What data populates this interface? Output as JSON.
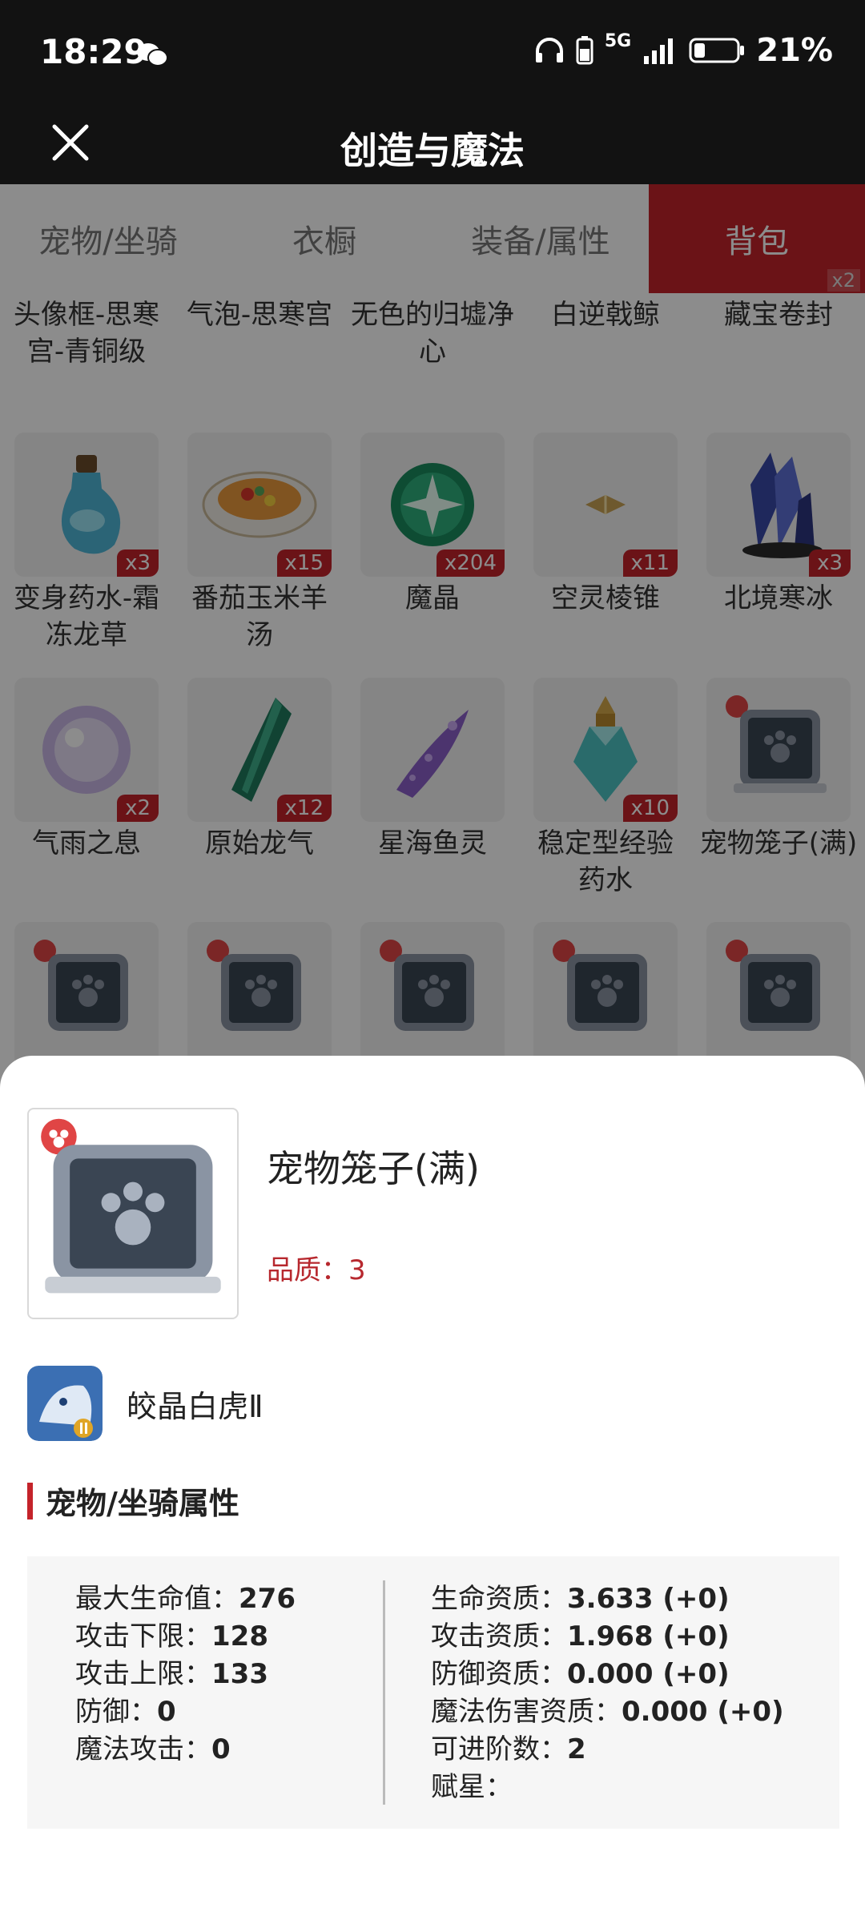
{
  "status_bar": {
    "time": "18:29",
    "network": "5G",
    "battery": "21%"
  },
  "header": {
    "title": "创造与魔法"
  },
  "tabs": [
    {
      "label": "宠物/坐骑",
      "active": false
    },
    {
      "label": "衣橱",
      "active": false
    },
    {
      "label": "装备/属性",
      "active": false
    },
    {
      "label": "背包",
      "active": true,
      "badge": "x2"
    }
  ],
  "inventory": {
    "partial_row": [
      "头像框-思寒宫-青铜级",
      "气泡-思寒宫",
      "无色的归墟净心",
      "白逆戟鲸",
      "藏宝卷封"
    ],
    "rows": [
      [
        {
          "name": "变身药水-霜冻龙草",
          "count": "x3",
          "icon": "potion-icon"
        },
        {
          "name": "番茄玉米羊汤",
          "count": "x15",
          "icon": "soup-bowl-icon"
        },
        {
          "name": "魔晶",
          "count": "x204",
          "icon": "magic-crystal-icon"
        },
        {
          "name": "空灵棱锥",
          "count": "x11",
          "icon": "pyramid-icon"
        },
        {
          "name": "北境寒冰",
          "count": "x3",
          "icon": "ice-crystal-icon"
        }
      ],
      [
        {
          "name": "气雨之息",
          "count": "x2",
          "icon": "orb-icon"
        },
        {
          "name": "原始龙气",
          "count": "x12",
          "icon": "dragon-shard-icon"
        },
        {
          "name": "星海鱼灵",
          "count": "",
          "icon": "star-fish-spirit-icon"
        },
        {
          "name": "稳定型经验药水",
          "count": "x10",
          "icon": "exp-potion-icon"
        },
        {
          "name": "宠物笼子(满)",
          "count": "",
          "icon": "pet-cage-icon"
        }
      ],
      [
        {
          "name": "",
          "count": "",
          "icon": "pet-cage-icon"
        },
        {
          "name": "",
          "count": "",
          "icon": "pet-cage-icon"
        },
        {
          "name": "",
          "count": "",
          "icon": "pet-cage-icon"
        },
        {
          "name": "",
          "count": "",
          "icon": "pet-cage-icon"
        },
        {
          "name": "",
          "count": "",
          "icon": "pet-cage-icon"
        }
      ]
    ]
  },
  "detail": {
    "item_name": "宠物笼子(满)",
    "quality": "品质：3",
    "pet_name": "皎晶白虎Ⅱ",
    "section_title": "宠物/坐骑属性",
    "left_attrs": [
      {
        "label": "最大生命值：",
        "value": "276"
      },
      {
        "label": "攻击下限：",
        "value": "128"
      },
      {
        "label": "攻击上限：",
        "value": "133"
      },
      {
        "label": "防御：",
        "value": "0"
      },
      {
        "label": "魔法攻击：",
        "value": "0"
      }
    ],
    "right_attrs": [
      {
        "label": "生命资质：",
        "value": "3.633 (+0)"
      },
      {
        "label": "攻击资质：",
        "value": "1.968 (+0)"
      },
      {
        "label": "防御资质：",
        "value": "0.000 (+0)"
      },
      {
        "label": "魔法伤害资质：",
        "value": "0.000 (+0)"
      },
      {
        "label": "可进阶数：",
        "value": "2"
      },
      {
        "label": "赋星：",
        "value": ""
      }
    ]
  },
  "colors": {
    "accent": "#c4232a",
    "header_bg": "#121212"
  }
}
